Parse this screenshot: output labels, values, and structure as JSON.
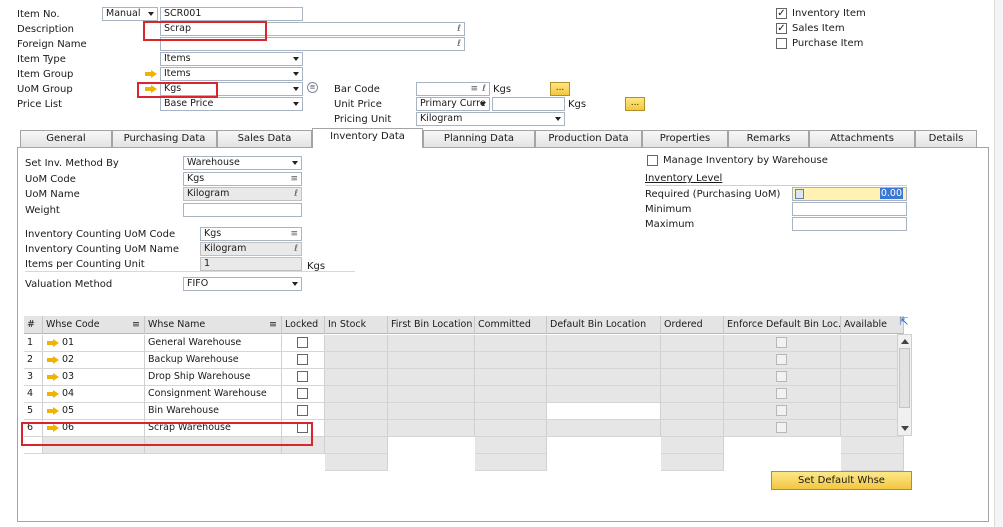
{
  "header": {
    "item_no_label": "Item No.",
    "item_no_series": "Manual",
    "item_no_value": "SCR001",
    "description_label": "Description",
    "description_value": "Scrap",
    "foreign_name_label": "Foreign Name",
    "foreign_name_value": "",
    "item_type_label": "Item Type",
    "item_type_value": "Items",
    "item_group_label": "Item Group",
    "item_group_value": "Items",
    "uom_group_label": "UoM Group",
    "uom_group_value": "Kgs",
    "price_list_label": "Price List",
    "price_list_value": "Base Price",
    "bar_code_label": "Bar Code",
    "bar_code_value": "",
    "bar_code_unit": "Kgs",
    "unit_price_label": "Unit Price",
    "unit_price_currency": "Primary Curre",
    "unit_price_value": "",
    "unit_price_unit": "Kgs",
    "pricing_unit_label": "Pricing Unit",
    "pricing_unit_value": "Kilogram",
    "inventory_item_label": "Inventory Item",
    "inventory_item_checked": true,
    "sales_item_label": "Sales Item",
    "sales_item_checked": true,
    "purchase_item_label": "Purchase Item",
    "purchase_item_checked": false,
    "dots_button": "..."
  },
  "tabs": [
    {
      "label": "General",
      "active": false
    },
    {
      "label": "Purchasing Data",
      "active": false
    },
    {
      "label": "Sales Data",
      "active": false
    },
    {
      "label": "Inventory Data",
      "active": true
    },
    {
      "label": "Planning Data",
      "active": false
    },
    {
      "label": "Production Data",
      "active": false
    },
    {
      "label": "Properties",
      "active": false
    },
    {
      "label": "Remarks",
      "active": false
    },
    {
      "label": "Attachments",
      "active": false
    },
    {
      "label": "Details",
      "active": false
    }
  ],
  "inventory": {
    "set_inv_method_label": "Set Inv. Method By",
    "set_inv_method_value": "Warehouse",
    "uom_code_label": "UoM Code",
    "uom_code_value": "Kgs",
    "uom_name_label": "UoM Name",
    "uom_name_value": "Kilogram",
    "weight_label": "Weight",
    "weight_value": "",
    "counting_uom_code_label": "Inventory Counting UoM Code",
    "counting_uom_code_value": "Kgs",
    "counting_uom_name_label": "Inventory Counting UoM Name",
    "counting_uom_name_value": "Kilogram",
    "items_per_counting_unit_label": "Items per Counting Unit",
    "items_per_counting_unit_value": "1",
    "items_per_counting_unit_uom": "Kgs",
    "valuation_method_label": "Valuation Method",
    "valuation_method_value": "FIFO",
    "manage_by_whse_label": "Manage Inventory by Warehouse",
    "manage_by_whse_checked": false,
    "inventory_level_label": "Inventory Level",
    "required_label": "Required (Purchasing UoM)",
    "required_value": "0.00",
    "minimum_label": "Minimum",
    "minimum_value": "",
    "maximum_label": "Maximum",
    "maximum_value": ""
  },
  "grid": {
    "columns": [
      "#",
      "Whse Code",
      "Whse Name",
      "Locked",
      "In Stock",
      "First Bin Location",
      "Committed",
      "Default Bin Location",
      "Ordered",
      "Enforce Default Bin Loc.",
      "Available"
    ],
    "rows": [
      {
        "num": "1",
        "code": "01",
        "name": "General Warehouse"
      },
      {
        "num": "2",
        "code": "02",
        "name": "Backup Warehouse"
      },
      {
        "num": "3",
        "code": "03",
        "name": "Drop Ship Warehouse"
      },
      {
        "num": "4",
        "code": "04",
        "name": "Consignment Warehouse"
      },
      {
        "num": "5",
        "code": "05",
        "name": "Bin Warehouse"
      },
      {
        "num": "6",
        "code": "06",
        "name": "Scrap Warehouse"
      }
    ]
  },
  "set_default_whse_button": "Set Default Whse",
  "colors": {
    "highlight_box": "#d9262c",
    "button_yellow": "#f2c642",
    "arrow": "#f0b400"
  }
}
